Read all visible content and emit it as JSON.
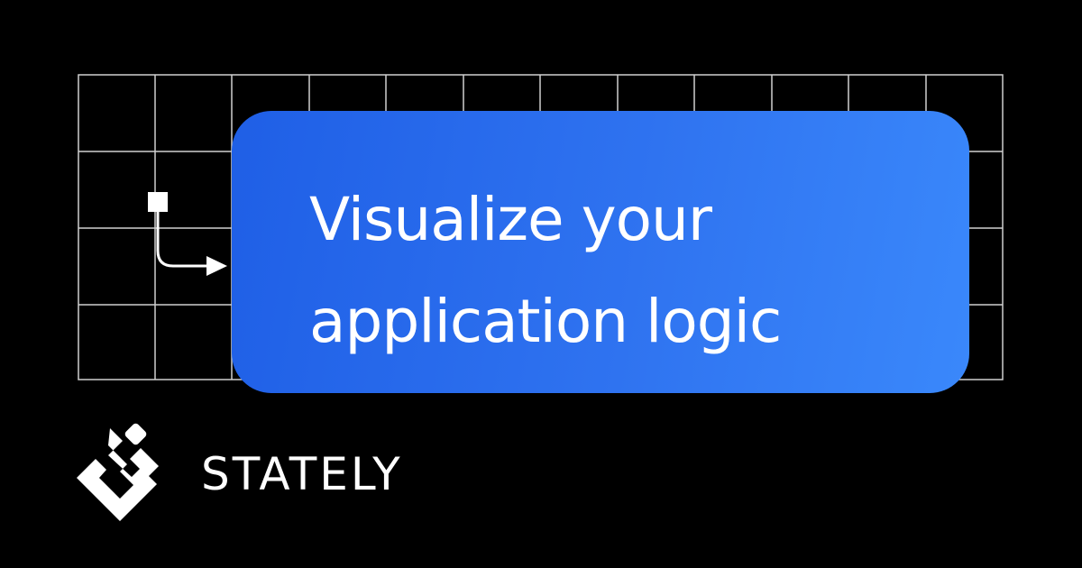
{
  "headline": {
    "line1": "Visualize your",
    "line2": "application logic"
  },
  "brand": {
    "name": "STATELY",
    "logo_icon": "stately-logo-icon"
  },
  "decor": {
    "grid_icon": "grid-background",
    "connector_icon": "transition-arrow-icon"
  },
  "colors": {
    "background": "#000000",
    "grid_line": "#cfcfcf",
    "card_gradient_start": "#1f5fe6",
    "card_gradient_end": "#3a88fb",
    "text": "#ffffff"
  }
}
